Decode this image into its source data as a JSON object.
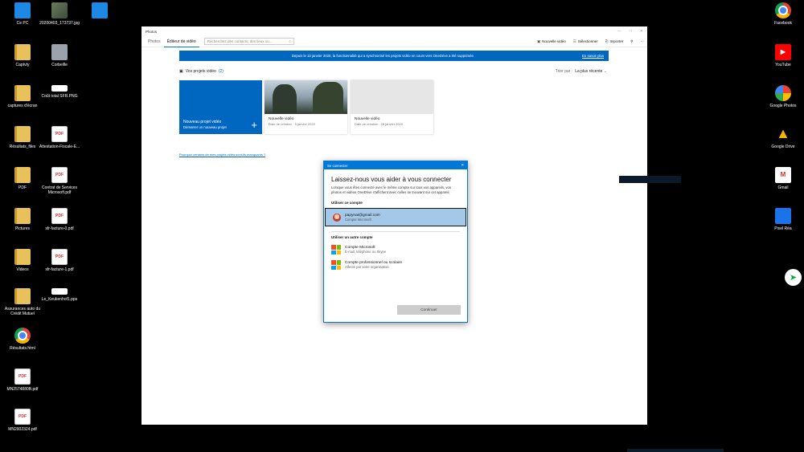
{
  "desktop_left": [
    {
      "label": "Ce PC",
      "icon": "pc",
      "glyph": ""
    },
    {
      "label": "20200403_173737.jpg",
      "icon": "img",
      "glyph": ""
    },
    {
      "label": "",
      "icon": "pc",
      "glyph": ""
    },
    {
      "label": "Captvty",
      "icon": "folder",
      "glyph": ""
    },
    {
      "label": "Corbeille",
      "icon": "bin",
      "glyph": ""
    },
    {
      "label": "captures d'écran",
      "icon": "folder",
      "glyph": ""
    },
    {
      "label": "Coût total SFR.PNG",
      "icon": "rect",
      "glyph": ""
    },
    {
      "label": "Résultats_files",
      "icon": "folder",
      "glyph": ""
    },
    {
      "label": "Attestation-Fiscale-E...",
      "icon": "pdf",
      "glyph": "PDF"
    },
    {
      "label": "PDF",
      "icon": "folder",
      "glyph": ""
    },
    {
      "label": "Contrat de Services Microsoft.pdf",
      "icon": "pdf",
      "glyph": "PDF"
    },
    {
      "label": "Pictures",
      "icon": "folder",
      "glyph": ""
    },
    {
      "label": "sfr-facture-0.pdf",
      "icon": "pdf",
      "glyph": "PDF"
    },
    {
      "label": "Videos",
      "icon": "folder",
      "glyph": ""
    },
    {
      "label": "sfr-facture-1.pdf",
      "icon": "pdf",
      "glyph": "PDF"
    },
    {
      "label": "Assurances auto du Crédit Mutuel",
      "icon": "folder",
      "glyph": ""
    },
    {
      "label": "Le_Keukenhof1.pps",
      "icon": "rect",
      "glyph": ""
    },
    {
      "label": "Résultats.html",
      "icon": "chrome",
      "glyph": ""
    },
    {
      "label": "MN2574880B.pdf",
      "icon": "pdf",
      "glyph": "PDF"
    },
    {
      "label": "MN2902324.pdf",
      "icon": "pdf",
      "glyph": "PDF"
    }
  ],
  "desktop_right": [
    {
      "label": "Facebook",
      "icon": "chrome",
      "glyph": ""
    },
    {
      "label": "YouTube",
      "icon": "yt",
      "glyph": "▶"
    },
    {
      "label": "Google Photos",
      "icon": "gphotos",
      "glyph": ""
    },
    {
      "label": "Google Drive",
      "icon": "drive",
      "glyph": "▲"
    },
    {
      "label": "Gmail",
      "icon": "gmail",
      "glyph": "M"
    },
    {
      "label": "Pixel Réa",
      "icon": "pixel",
      "glyph": ""
    }
  ],
  "window": {
    "app_title": "Photos",
    "tabs": [
      "Photos",
      "Éditeur de vidéo"
    ],
    "search_placeholder": "Recherchez des contacts, des lieux ou...",
    "actions": {
      "new_video": "Nouvelle vidéo",
      "select": "Sélectionner",
      "import": "Importer"
    }
  },
  "banner": {
    "message": "Depuis le 10 janvier 2020, la fonctionnalité qui a synchronisé les projets vidéo en cours vers OneDrive a été supprimée.",
    "link": "En savoir plus"
  },
  "projects": {
    "heading": "Vos projets vidéo",
    "count": "(2)",
    "sort_label": "Trier par :",
    "sort_value": "La plus récente",
    "new_title": "Nouveau projet vidéo",
    "new_sub": "Démarrer un nouveau projet",
    "items": [
      {
        "title": "Nouvelle vidéo",
        "date": "Date de création : 5 janvier 2020"
      },
      {
        "title": "Nouvelle vidéo",
        "date": "Date de création : 28 janvier 2020"
      }
    ],
    "missing_link": "Pourquoi certains de mes projets vidéo sont-ils manquants ?"
  },
  "dialog": {
    "title": "Se connecter",
    "heading": "Laissez-nous vous aider à vous connecter",
    "body": "Lorsque vous êtes connecté avec le même compte sur tous vos appareils, vos photos et vidéos OneDrive s'affichent avec celles se trouvant sur cet appareil.",
    "use_this": "Utiliser ce compte",
    "account_email": "papynat@gmail.com",
    "account_type": "Compte Microsoft",
    "use_other": "Utiliser un autre compte",
    "options": [
      {
        "title": "Compte Microsoft",
        "sub": "E-mail, téléphone ou Skype"
      },
      {
        "title": "Compte professionnel ou scolaire",
        "sub": "Affecté par votre organisation"
      }
    ],
    "continue": "Continuer"
  },
  "colors": {
    "accent": "#0078d7",
    "banner": "#0067c0",
    "selected": "#a3c8e8"
  }
}
